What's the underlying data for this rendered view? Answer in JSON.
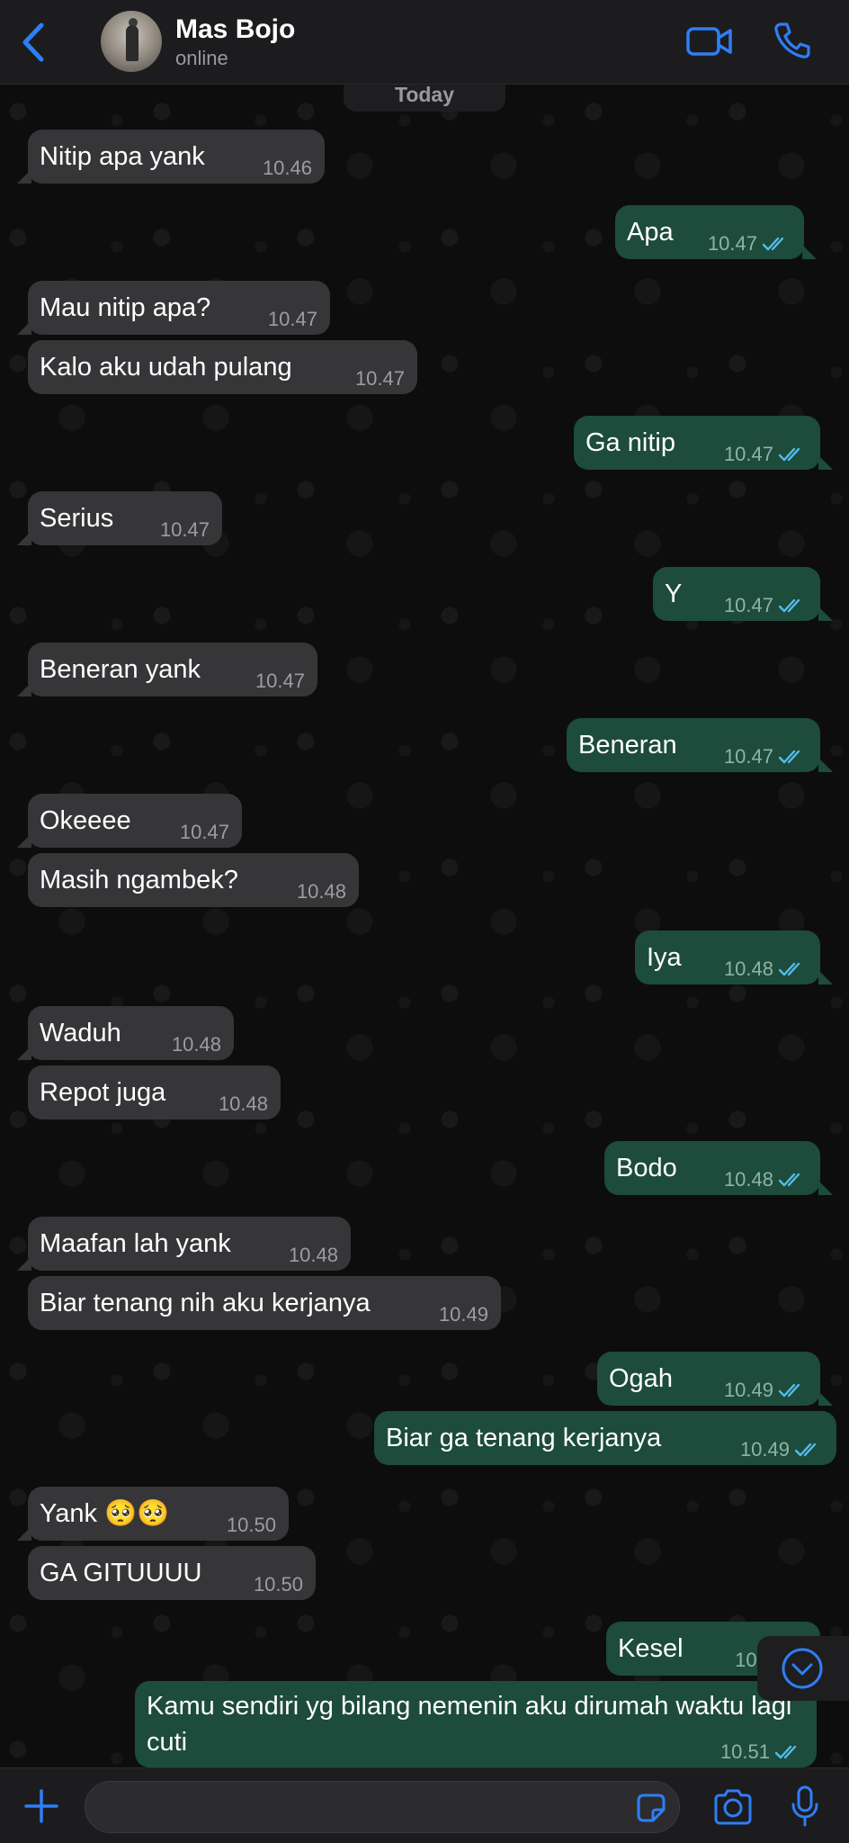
{
  "header": {
    "back_icon": "chevron-left-icon",
    "contact_name": "Mas Bojo",
    "status": "online",
    "video_icon": "video-camera-icon",
    "call_icon": "phone-icon"
  },
  "colors": {
    "accent": "#2f7ef5",
    "incoming_bubble": "#363638",
    "outgoing_bubble": "#1d4b3c",
    "read_ticks": "#53bdeb"
  },
  "chat": {
    "date_label": "Today",
    "messages": [
      {
        "dir": "in",
        "text": "Nitip apa yank",
        "time": "10.46"
      },
      {
        "dir": "out",
        "text": "Apa",
        "time": "10.47"
      },
      {
        "dir": "in",
        "text": "Mau nitip apa?",
        "time": "10.47"
      },
      {
        "dir": "in",
        "text": "Kalo aku udah pulang",
        "time": "10.47"
      },
      {
        "dir": "out",
        "text": "Ga nitip",
        "time": "10.47"
      },
      {
        "dir": "in",
        "text": "Serius",
        "time": "10.47"
      },
      {
        "dir": "out",
        "text": "Y",
        "time": "10.47"
      },
      {
        "dir": "in",
        "text": "Beneran yank",
        "time": "10.47"
      },
      {
        "dir": "out",
        "text": "Beneran",
        "time": "10.47"
      },
      {
        "dir": "in",
        "text": "Okeeee",
        "time": "10.47"
      },
      {
        "dir": "in",
        "text": "Masih ngambek?",
        "time": "10.48"
      },
      {
        "dir": "out",
        "text": "Iya",
        "time": "10.48"
      },
      {
        "dir": "in",
        "text": "Waduh",
        "time": "10.48"
      },
      {
        "dir": "in",
        "text": "Repot juga",
        "time": "10.48"
      },
      {
        "dir": "out",
        "text": "Bodo",
        "time": "10.48"
      },
      {
        "dir": "in",
        "text": "Maafan lah yank",
        "time": "10.48"
      },
      {
        "dir": "in",
        "text": "Biar tenang nih aku kerjanya",
        "time": "10.49"
      },
      {
        "dir": "out",
        "text": "Ogah",
        "time": "10.49"
      },
      {
        "dir": "out",
        "text": "Biar ga tenang kerjanya",
        "time": "10.49"
      },
      {
        "dir": "in",
        "text": "Yank 🥺🥺",
        "time": "10.50"
      },
      {
        "dir": "in",
        "text": "GA GITUUUU",
        "time": "10.50"
      },
      {
        "dir": "out",
        "text": "Kesel",
        "time": "10.5"
      },
      {
        "dir": "out",
        "text": "Kamu sendiri yg bilang nemenin aku dirumah waktu lagi cuti",
        "time": "10.51"
      }
    ],
    "scroll_down_icon": "chevron-down-circle-icon"
  },
  "input_bar": {
    "plus_icon": "plus-icon",
    "placeholder": "",
    "sticker_icon": "sticker-icon",
    "camera_icon": "camera-icon",
    "mic_icon": "microphone-icon"
  }
}
